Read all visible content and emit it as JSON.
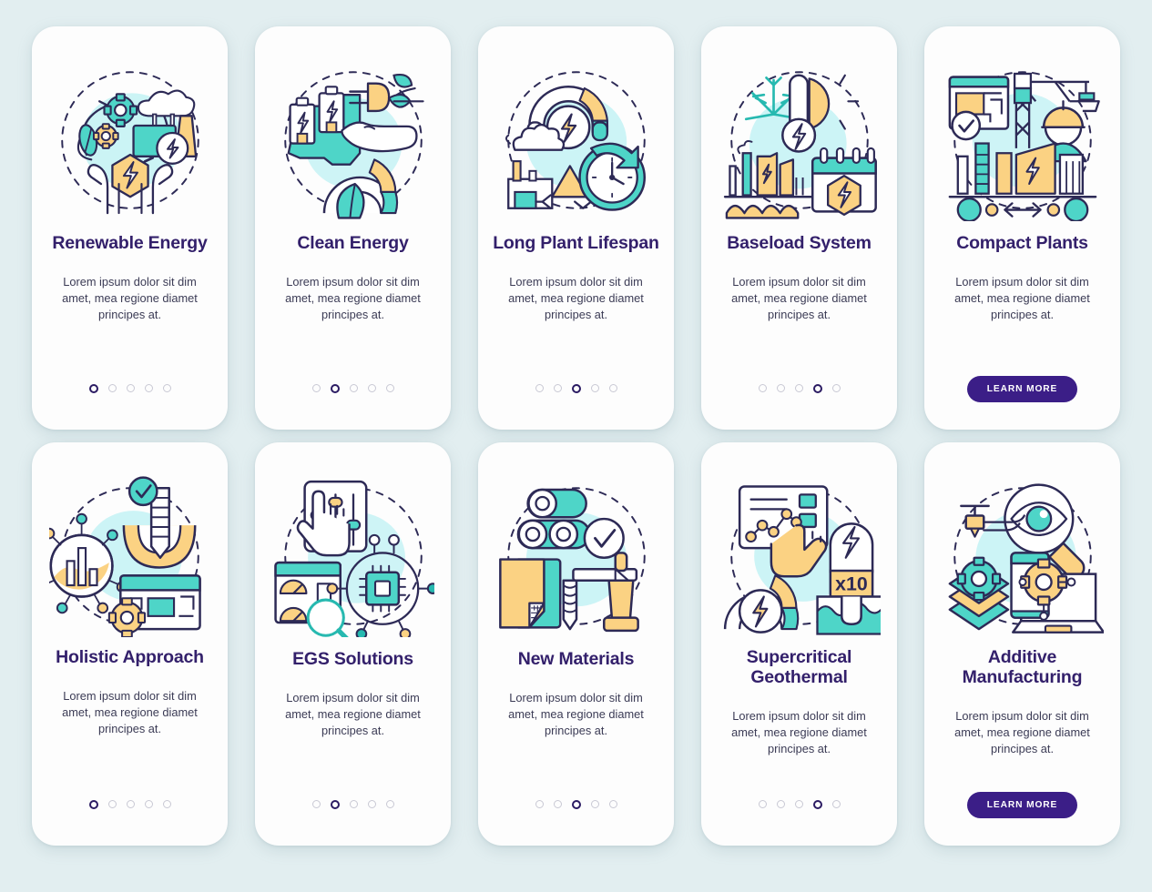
{
  "page": {
    "background_color": "#e2eef0",
    "card_background": "#fdfdfd",
    "title_color": "#33206b",
    "body_color": "#3b3b55",
    "accent_button_color": "#3b1e87",
    "dot_active_color": "#2b1b63",
    "dot_inactive_color": "#c9c9d4",
    "palette": {
      "teal": "#4ed5c8",
      "teal_dark": "#27b9b0",
      "yellow": "#fbd283",
      "light_blue": "#b9f0f2",
      "outline": "#2d2a56",
      "white": "#ffffff"
    }
  },
  "shared": {
    "body_text": "Lorem ipsum dolor sit dim amet, mea regione diamet principes at.",
    "learn_more_label": "LEARN MORE",
    "dot_count": 5,
    "x10_label": "x10"
  },
  "cards": [
    {
      "title": "Renewable Energy",
      "body": "Lorem ipsum dolor sit dim amet, mea regione diamet principes at.",
      "icon": "renewable-energy-icon",
      "footer": "dots",
      "active_dot": 1
    },
    {
      "title": "Clean Energy",
      "body": "Lorem ipsum dolor sit dim amet, mea regione diamet principes at.",
      "icon": "clean-energy-icon",
      "footer": "dots",
      "active_dot": 2
    },
    {
      "title": "Long Plant Lifespan",
      "body": "Lorem ipsum dolor sit dim amet, mea regione diamet principes at.",
      "icon": "long-plant-lifespan-icon",
      "footer": "dots",
      "active_dot": 3
    },
    {
      "title": "Baseload System",
      "body": "Lorem ipsum dolor sit dim amet, mea regione diamet principes at.",
      "icon": "baseload-system-icon",
      "footer": "dots",
      "active_dot": 4
    },
    {
      "title": "Compact Plants",
      "body": "Lorem ipsum dolor sit dim amet, mea regione diamet principes at.",
      "icon": "compact-plants-icon",
      "footer": "button",
      "active_dot": 0
    },
    {
      "title": "Holistic Approach",
      "body": "Lorem ipsum dolor sit dim amet, mea regione diamet principes at.",
      "icon": "holistic-approach-icon",
      "footer": "dots",
      "active_dot": 1
    },
    {
      "title": "EGS Solutions",
      "body": "Lorem ipsum dolor sit dim amet, mea regione diamet principes at.",
      "icon": "egs-solutions-icon",
      "footer": "dots",
      "active_dot": 2
    },
    {
      "title": "New Materials",
      "body": "Lorem ipsum dolor sit dim amet, mea regione diamet principes at.",
      "icon": "new-materials-icon",
      "footer": "dots",
      "active_dot": 3
    },
    {
      "title": "Supercritical Geothermal",
      "body": "Lorem ipsum dolor sit dim amet, mea regione diamet principes at.",
      "icon": "supercritical-geothermal-icon",
      "footer": "dots",
      "active_dot": 4
    },
    {
      "title": "Additive Manufacturing",
      "body": "Lorem ipsum dolor sit dim amet, mea regione diamet principes at.",
      "icon": "additive-manufacturing-icon",
      "footer": "button",
      "active_dot": 0
    }
  ]
}
